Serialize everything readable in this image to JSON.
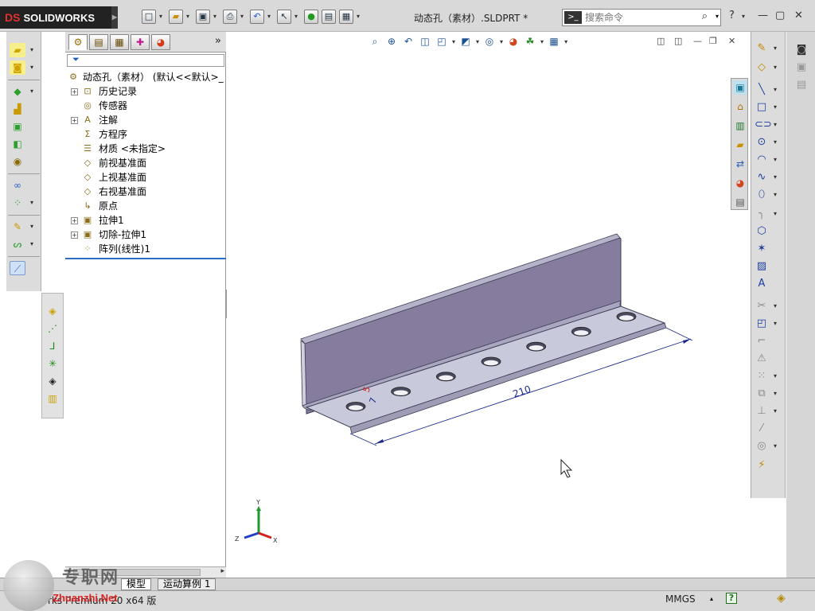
{
  "app": {
    "brand": "SOLIDWORKS",
    "brand_mark": "DS",
    "document_title": "动态孔（素材）.SLDPRT *"
  },
  "search": {
    "placeholder": "搜索命令"
  },
  "feature_tree": {
    "root_label": "动态孔（素材） (默认<<默认>_",
    "items": [
      {
        "label": "历史记录",
        "icon": "history-icon",
        "expandable": true
      },
      {
        "label": "传感器",
        "icon": "sensor-icon",
        "expandable": false
      },
      {
        "label": "注解",
        "icon": "annotation-icon",
        "expandable": true
      },
      {
        "label": "方程序",
        "icon": "equation-icon",
        "expandable": false
      },
      {
        "label": "材质 <未指定>",
        "icon": "material-icon",
        "expandable": false
      },
      {
        "label": "前视基准面",
        "icon": "plane-icon",
        "expandable": false
      },
      {
        "label": "上视基准面",
        "icon": "plane-icon",
        "expandable": false
      },
      {
        "label": "右视基准面",
        "icon": "plane-icon",
        "expandable": false
      },
      {
        "label": "原点",
        "icon": "origin-icon",
        "expandable": false
      },
      {
        "label": "拉伸1",
        "icon": "extrude-icon",
        "expandable": true
      },
      {
        "label": "切除-拉伸1",
        "icon": "cut-extrude-icon",
        "expandable": true
      },
      {
        "label": "阵列(线性)1",
        "icon": "linear-pattern-icon",
        "expandable": false
      }
    ]
  },
  "model": {
    "dimension_210": "210",
    "dimension_7": "7",
    "dimension_5": "5",
    "hole_count": 7,
    "triad_x": "X",
    "triad_y": "Y",
    "triad_z": "Z",
    "colors": {
      "face_light": "#c7c8d8",
      "face_dark": "#8e84a6",
      "edge": "#3d3d56",
      "dimension": "#1b2a8c"
    }
  },
  "tabs": {
    "model": "模型",
    "motion": "运动算例 1"
  },
  "status": {
    "left_text": "rks Premium 20   x64 版",
    "units": "MMGS"
  },
  "watermark": {
    "site": "专职网",
    "url": "Zhuanzhi.Net"
  }
}
